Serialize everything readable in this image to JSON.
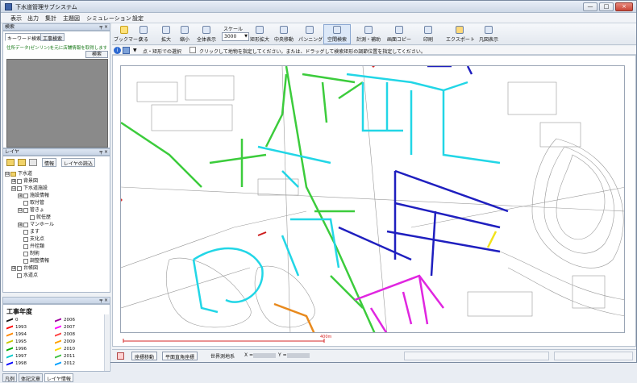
{
  "window": {
    "title": "下水道管理サブシステム",
    "min": "—",
    "max": "□",
    "close": "×"
  },
  "menu": [
    "表示",
    "出力",
    "集計",
    "主題図",
    "シミュレーション",
    "設定"
  ],
  "toolbar": {
    "buttons": [
      {
        "label": "ブックマーク",
        "icon": "star-icon"
      },
      {
        "label": "戻る",
        "icon": "back-icon"
      },
      {
        "label": "拡大",
        "icon": "zoom-in-icon"
      },
      {
        "label": "縮小",
        "icon": "zoom-out-icon"
      },
      {
        "label": "全体表示",
        "icon": "full-extent-icon"
      },
      {
        "label": "矩形拡大",
        "icon": "rect-zoom-icon"
      },
      {
        "label": "中央移動",
        "icon": "center-move-icon"
      },
      {
        "label": "パンニング",
        "icon": "pan-hand-icon"
      },
      {
        "label": "空間検索",
        "icon": "spatial-search-icon"
      },
      {
        "label": "計測・補助",
        "icon": "measure-icon"
      },
      {
        "label": "画面コピー",
        "icon": "screen-copy-icon"
      },
      {
        "label": "印刷",
        "icon": "print-icon"
      },
      {
        "label": "エクスポート",
        "icon": "export-icon"
      },
      {
        "label": "凡図表示",
        "icon": "overview-icon"
      }
    ],
    "scale_label": "スケール",
    "scale_value": "3000"
  },
  "left": {
    "search_header": "検索",
    "search_tabs": [
      "キーワード検索",
      "工事検索"
    ],
    "search_hint": "住所データ(ゼンリン)を元に店舗情報を取得します",
    "search_button": "検索",
    "layer_header": "レイヤ",
    "layer_tools": {
      "info": "情報",
      "reload": "レイヤの読込"
    },
    "tree": [
      {
        "label": "下水道",
        "level": 0,
        "kind": "folder",
        "toggle": "⊟"
      },
      {
        "label": "背景図",
        "level": 1,
        "kind": "check",
        "toggle": "⊞"
      },
      {
        "label": "下水道施設",
        "level": 1,
        "kind": "check",
        "toggle": "⊟"
      },
      {
        "label": "施設情報",
        "level": 2,
        "kind": "check",
        "toggle": "⊞"
      },
      {
        "label": "取付管",
        "level": 2,
        "kind": "check",
        "toggle": ""
      },
      {
        "label": "管きょ",
        "level": 2,
        "kind": "check",
        "toggle": "⊟"
      },
      {
        "label": "就任歴",
        "level": 3,
        "kind": "check",
        "toggle": ""
      },
      {
        "label": "マンホール",
        "level": 2,
        "kind": "check",
        "toggle": "⊞"
      },
      {
        "label": "ます",
        "level": 2,
        "kind": "check",
        "toggle": ""
      },
      {
        "label": "支化点",
        "level": 2,
        "kind": "check",
        "toggle": ""
      },
      {
        "label": "弁栓類",
        "level": 2,
        "kind": "check",
        "toggle": ""
      },
      {
        "label": "制術",
        "level": 2,
        "kind": "check",
        "toggle": ""
      },
      {
        "label": "調整情報",
        "level": 2,
        "kind": "check",
        "toggle": ""
      },
      {
        "label": "台帳図",
        "level": 1,
        "kind": "check",
        "toggle": "⊞"
      },
      {
        "label": "水道点",
        "level": 1,
        "kind": "check",
        "toggle": ""
      }
    ],
    "legend_title": "工事年度",
    "legend_years": [
      {
        "year": "0",
        "color": "#1a1a1a"
      },
      {
        "year": "1993",
        "color": "#ff0000"
      },
      {
        "year": "1994",
        "color": "#ff8800"
      },
      {
        "year": "1995",
        "color": "#c8c800"
      },
      {
        "year": "1996",
        "color": "#00aa00"
      },
      {
        "year": "1997",
        "color": "#00c8c8"
      },
      {
        "year": "1998",
        "color": "#0000ff"
      },
      {
        "year": "2006",
        "color": "#a000a0"
      },
      {
        "year": "2007",
        "color": "#ff00ff"
      },
      {
        "year": "2008",
        "color": "#ff4040"
      },
      {
        "year": "2009",
        "color": "#ffa000"
      },
      {
        "year": "2010",
        "color": "#ffd700"
      },
      {
        "year": "2011",
        "color": "#40c040"
      },
      {
        "year": "2012",
        "color": "#00a0ff"
      }
    ],
    "bottom_tabs": [
      "凡例",
      "体記文章",
      "レイヤ情報"
    ]
  },
  "message": {
    "select_label": "点・矩形での選択",
    "text": "クリックして地物を指定してください。または、ドラッグして検索矩形の調節位置を指定してください。"
  },
  "scalebar": {
    "label": "400m"
  },
  "status": {
    "coord_move": "座標移動",
    "coord_system": "平面直角座標",
    "world_label": "世界測地系",
    "x_label": "X =",
    "y_label": "Y ="
  }
}
